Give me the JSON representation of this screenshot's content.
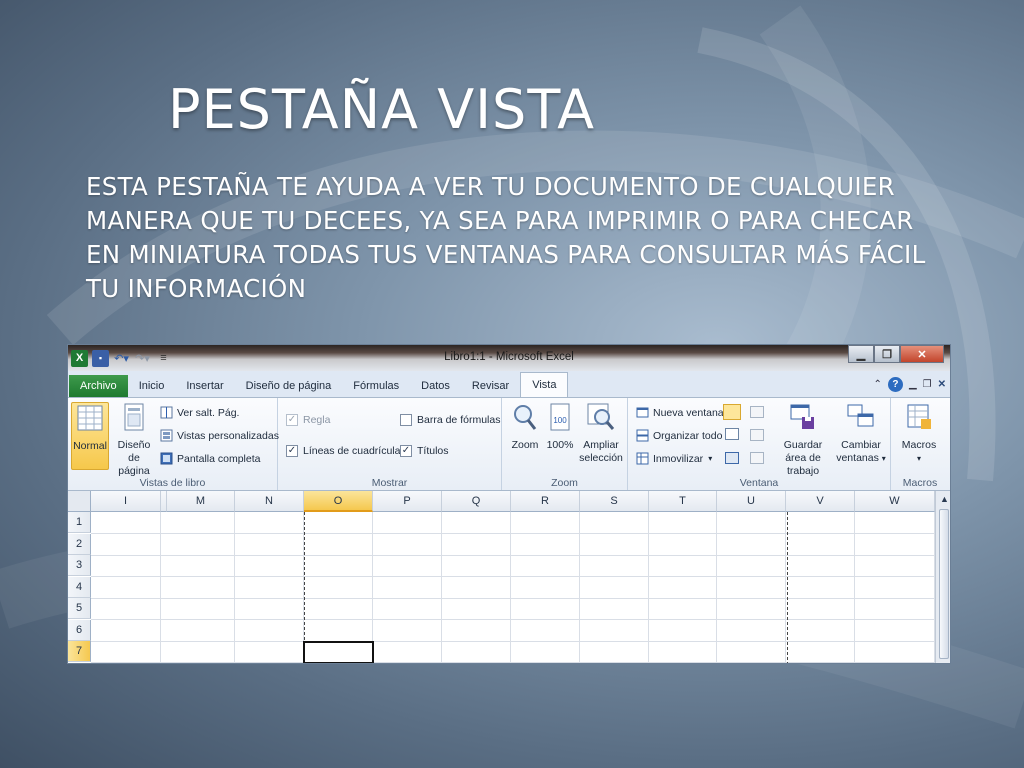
{
  "slide": {
    "title": "PESTAÑA VISTA",
    "body": "ESTA PESTAÑA TE AYUDA A VER TU DOCUMENTO DE CUALQUIER MANERA QUE TU DECEES, YA SEA PARA IMPRIMIR O PARA CHECAR EN MINIATURA TODAS TUS VENTANAS PARA CONSULTAR MÁS FÁCIL TU INFORMACIÓN"
  },
  "excel": {
    "window_title": "Libro1:1 - Microsoft Excel",
    "tabs": [
      "Archivo",
      "Inicio",
      "Insertar",
      "Diseño de página",
      "Fórmulas",
      "Datos",
      "Revisar",
      "Vista"
    ],
    "active_tab": "Vista",
    "groups": {
      "vistas_de_libro": {
        "label": "Vistas de libro",
        "normal": "Normal",
        "diseno_pagina": "Diseño de página",
        "ver_salt": "Ver salt. Pág.",
        "vistas_personalizadas": "Vistas personalizadas",
        "pantalla_completa": "Pantalla completa"
      },
      "mostrar": {
        "label": "Mostrar",
        "regla": "Regla",
        "lineas": "Líneas de cuadrícula",
        "barra": "Barra de fórmulas",
        "titulos": "Títulos"
      },
      "zoom": {
        "label": "Zoom",
        "zoom": "Zoom",
        "cien": "100%",
        "ampliar": "Ampliar selección"
      },
      "ventana": {
        "label": "Ventana",
        "nueva": "Nueva ventana",
        "organizar": "Organizar todo",
        "inmovilizar": "Inmovilizar",
        "guardar": "Guardar área de trabajo",
        "cambiar": "Cambiar ventanas"
      },
      "macros": {
        "label": "Macros",
        "macros": "Macros"
      }
    },
    "columns": [
      "I",
      "M",
      "N",
      "O",
      "P",
      "Q",
      "R",
      "S",
      "T",
      "U",
      "V",
      "W"
    ],
    "rows": [
      "1",
      "2",
      "3",
      "4",
      "5",
      "6",
      "7"
    ],
    "selected_column": "O",
    "selected_row": "7"
  }
}
